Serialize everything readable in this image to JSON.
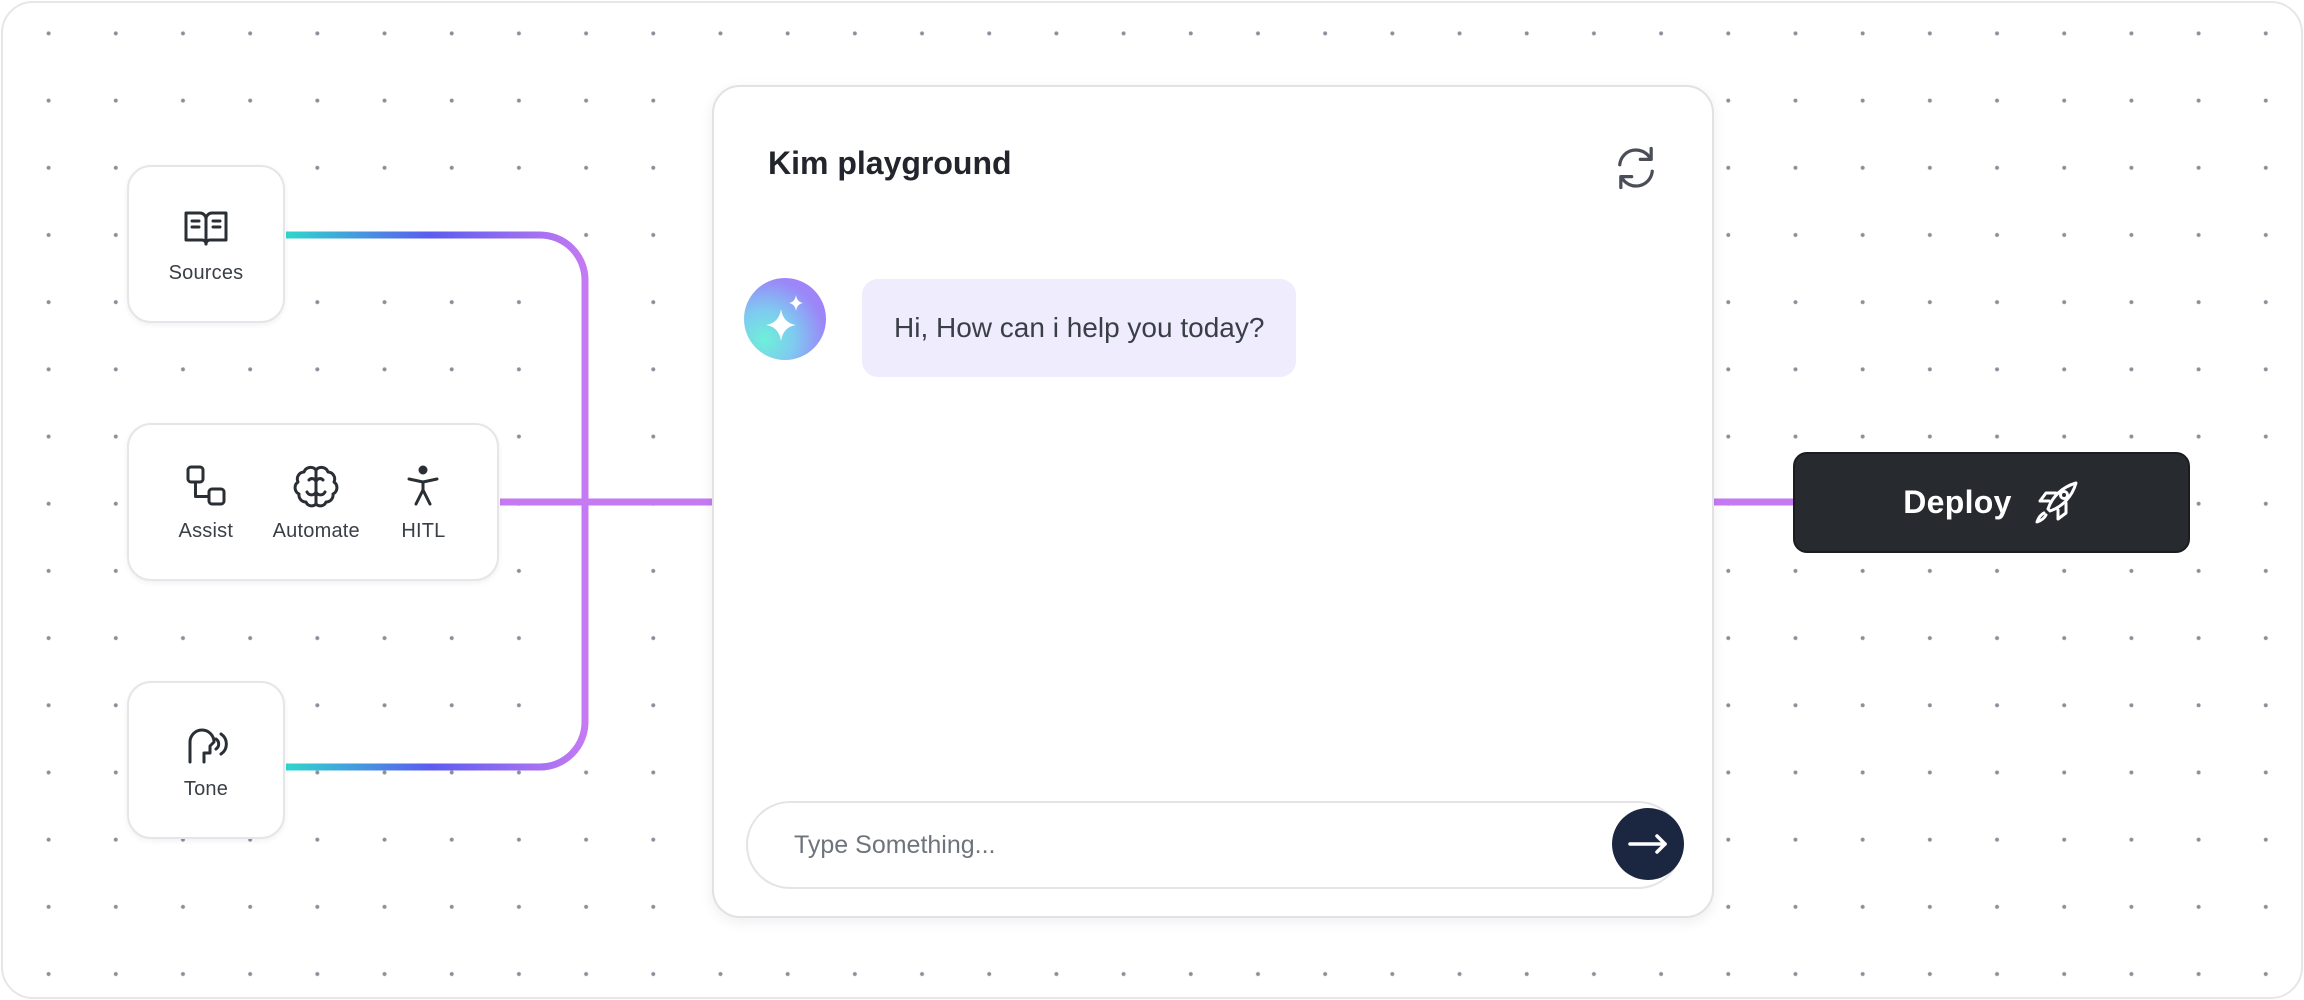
{
  "sources": {
    "label": "Sources",
    "icon": "book-open-icon"
  },
  "actions": [
    {
      "label": "Assist",
      "icon": "workflow-icon"
    },
    {
      "label": "Automate",
      "icon": "brain-icon"
    },
    {
      "label": "HITL",
      "icon": "person-icon"
    }
  ],
  "tone": {
    "label": "Tone",
    "icon": "speaking-head-icon"
  },
  "chat": {
    "title": "Kim playground",
    "refresh_icon": "refresh-icon",
    "avatar_icon": "sparkle-icon",
    "message": "Hi, How can i help you today?",
    "input_placeholder": "Type Something...",
    "send_icon": "arrow-right-icon"
  },
  "deploy": {
    "label": "Deploy",
    "icon": "rocket-icon"
  },
  "colors": {
    "connector_teal": "#2fd6cc",
    "connector_blue": "#5b5cf0",
    "connector_purple": "#c57af3",
    "bubble": "#eeecfd",
    "send_button": "#1b2640",
    "deploy_button": "#272a2f"
  }
}
